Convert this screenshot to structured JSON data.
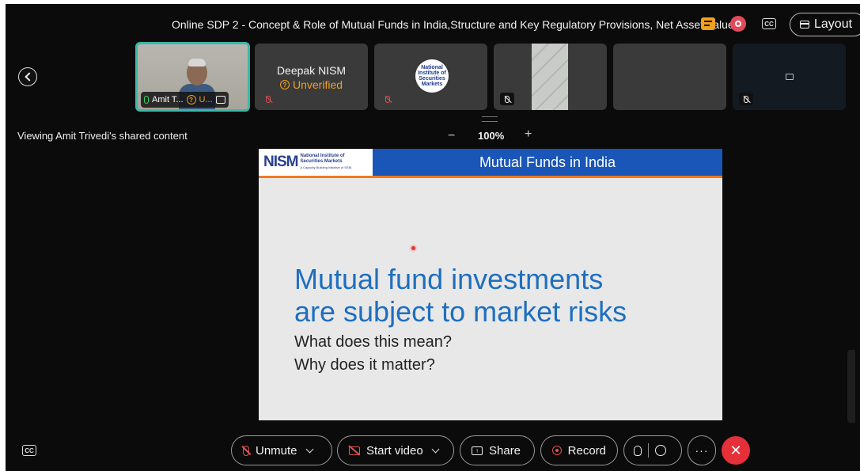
{
  "header": {
    "meeting_title": "Online SDP 2 - Concept & Role of Mutual Funds in India,Structure and Key Regulatory Provisions, Net Asset Value",
    "layout_label": "Layout",
    "cc_label": "CC"
  },
  "participants": [
    {
      "name": "Amit T...",
      "status": "U...",
      "active_speaker": true
    },
    {
      "name": "Deepak NISM",
      "status": "Unverified",
      "muted": true
    },
    {
      "avatar_text": "National Institute of Securities Markets",
      "muted": true
    },
    {
      "muted": true
    },
    {},
    {
      "muted": true
    }
  ],
  "share": {
    "viewing_label": "Viewing Amit Trivedi's shared content",
    "zoom_minus": "−",
    "zoom_value": "100%",
    "zoom_plus": "+"
  },
  "slide": {
    "logo_mark": "NISM",
    "logo_line1": "National Institute of",
    "logo_line2": "Securities Markets",
    "logo_line3": "A Capacity Building Initiative of SEBI",
    "title": "Mutual Funds in India",
    "headline_line1": "Mutual fund investments",
    "headline_line2": "are subject to market risks",
    "question1": "What does this mean?",
    "question2": "Why does it matter?"
  },
  "controls": {
    "unmute": "Unmute",
    "start_video": "Start video",
    "share": "Share",
    "record": "Record",
    "more": "···",
    "leave": "✕",
    "cc_bottom": "CC"
  },
  "colors": {
    "accent_orange": "#f0a020",
    "leave_red": "#e5303a",
    "speaker_border": "#3ab8a8",
    "slide_header_blue": "#1a55b8",
    "slide_text_blue": "#1e6fbf"
  }
}
